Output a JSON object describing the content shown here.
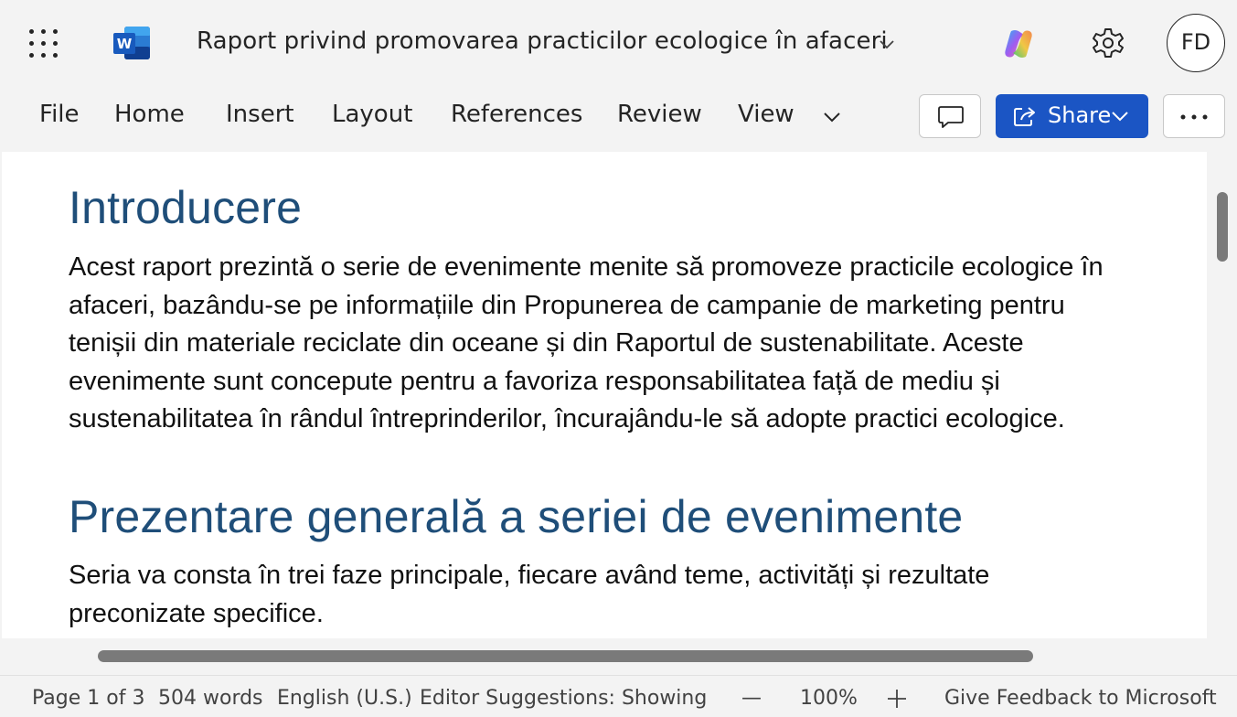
{
  "titlebar": {
    "doc_title": "Raport privind promovarea practicilor ecologice în afaceri",
    "avatar_initials": "FD",
    "icons": [
      "app-launcher-icon",
      "word-logo-icon",
      "chevron-down-icon",
      "copilot-icon",
      "gear-icon"
    ]
  },
  "ribbon": {
    "tabs": [
      "File",
      "Home",
      "Insert",
      "Layout",
      "References",
      "Review",
      "View"
    ],
    "share_label": "Share",
    "icons": [
      "comment-icon",
      "share-icon",
      "more-icon"
    ]
  },
  "document": {
    "heading1": "Introducere",
    "para1": [
      "Acest raport prezintă o serie de evenimente menite să promoveze practicile ecologice în",
      "afaceri, bazându-se pe informațiile din Propunerea de campanie de marketing pentru",
      "tenișii din materiale reciclate din oceane și din Raportul de sustenabilitate. Aceste",
      "evenimente sunt concepute pentru a favoriza responsabilitatea față de mediu și",
      "sustenabilitatea în rândul întreprinderilor, încurajându-le să adopte practici ecologice."
    ],
    "heading2": "Prezentare generală a seriei de evenimente",
    "para2": [
      "Seria va consta în trei faze principale, fiecare având teme, activități și rezultate",
      "preconizate specifice."
    ]
  },
  "statusbar": {
    "page": "Page 1 of 3",
    "words": "504 words",
    "language": "English (U.S.)",
    "editor": "Editor Suggestions: Showing",
    "zoom_out": "—",
    "zoom": "100%",
    "feedback": "Give Feedback to Microsoft"
  },
  "colors": {
    "accent": "#1b55c4",
    "heading": "#1f4e79",
    "background": "#f3f3f3"
  }
}
